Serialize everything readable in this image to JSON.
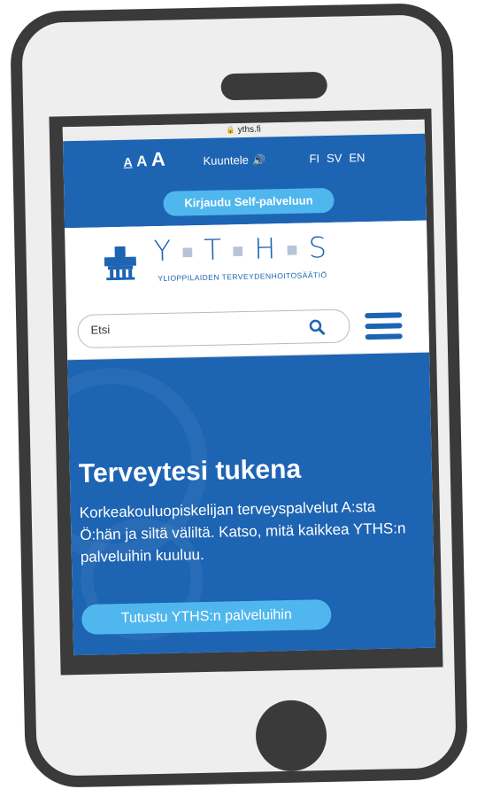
{
  "browser": {
    "url": "yths.fi"
  },
  "topbar": {
    "text_size_small": "A",
    "text_size_medium": "A",
    "text_size_large": "A",
    "listen_label": "Kuuntele",
    "languages": [
      "FI",
      "SV",
      "EN"
    ],
    "login_button": "Kirjaudu Self-palveluun"
  },
  "brand": {
    "letters": [
      "Y",
      "T",
      "H",
      "S"
    ],
    "tagline": "YLIOPPILAIDEN TERVEYDENHOITOSÄÄTIÖ"
  },
  "search": {
    "placeholder": "Etsi"
  },
  "hero": {
    "title": "Terveytesi tukena",
    "text": "Korkeakouluopiskelijan terveyspalvelut A:sta Ö:hän ja siltä väliltä. Katso, mitä kaikkea YTHS:n palveluihin kuuluu.",
    "button": "Tutustu YTHS:n palveluihin"
  },
  "colors": {
    "brand_blue": "#1d64b3",
    "accent_light_blue": "#4fb7ee",
    "phone_frame": "#3a3a3a"
  }
}
